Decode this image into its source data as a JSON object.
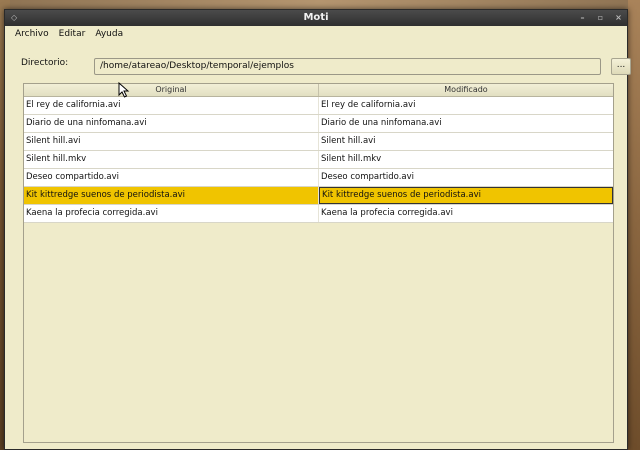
{
  "window": {
    "title": "Moti"
  },
  "titlebar": {
    "left_icon": "◇",
    "min": "–",
    "max": "▫",
    "close": "×"
  },
  "menu": {
    "items": [
      "Archivo",
      "Editar",
      "Ayuda"
    ]
  },
  "directory": {
    "label": "Directorio:",
    "value": "/home/atareao/Desktop/temporal/ejemplos",
    "browse_label": "..."
  },
  "table": {
    "headers": [
      "Original",
      "Modificado"
    ],
    "rows": [
      {
        "original": "El rey de california.avi",
        "modified": "El rey de california.avi"
      },
      {
        "original": "Diario de una ninfomana.avi",
        "modified": "Diario de una ninfomana.avi"
      },
      {
        "original": "Silent hill.avi",
        "modified": "Silent hill.avi"
      },
      {
        "original": "Silent hill.mkv",
        "modified": "Silent hill.mkv"
      },
      {
        "original": "Deseo compartido.avi",
        "modified": "Deseo compartido.avi"
      },
      {
        "original": "Kit kittredge suenos de periodista.avi",
        "modified": "Kit kittredge suenos de periodista.avi"
      },
      {
        "original": "Kaena la profecia corregida.avi",
        "modified": "Kaena la profecia corregida.avi"
      }
    ],
    "selected_row": 5
  },
  "colors": {
    "selection": "#f0c400",
    "window_bg": "#efebca",
    "titlebar": "#333333"
  }
}
